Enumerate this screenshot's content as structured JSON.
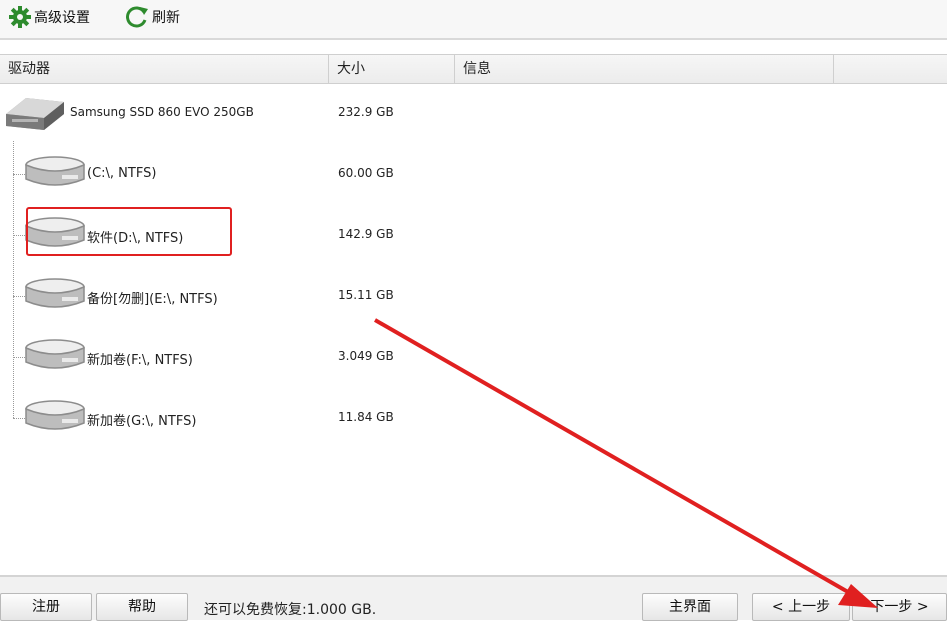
{
  "toolbar": {
    "advanced_label": "高级设置",
    "advanced_icon": "gear-icon",
    "refresh_label": "刷新",
    "refresh_icon": "refresh-icon",
    "icon_color": "#2e8b2e"
  },
  "columns": [
    "驱动器",
    "大小",
    "信息"
  ],
  "disk": {
    "name": "Samsung SSD 860 EVO 250GB",
    "size": "232.9 GB",
    "icon": "hard-drive-icon"
  },
  "partitions": [
    {
      "name": "(C:\\, NTFS)",
      "size": "60.00 GB",
      "icon": "partition-icon"
    },
    {
      "name": "软件(D:\\, NTFS)",
      "size": "142.9 GB",
      "icon": "partition-icon",
      "selected": true
    },
    {
      "name": "备份[勿删](E:\\, NTFS)",
      "size": "15.11 GB",
      "icon": "partition-icon"
    },
    {
      "name": "新加卷(F:\\, NTFS)",
      "size": "3.049 GB",
      "icon": "partition-icon"
    },
    {
      "name": "新加卷(G:\\, NTFS)",
      "size": "11.84 GB",
      "icon": "partition-icon"
    }
  ],
  "footer": {
    "register_label": "注册",
    "help_label": "帮助",
    "status_text": "还可以免费恢复:1.000 GB.",
    "main_label": "主界面",
    "prev_label": "< 上一步",
    "next_label": "下一步 >"
  },
  "annotation_color": "#e02020"
}
